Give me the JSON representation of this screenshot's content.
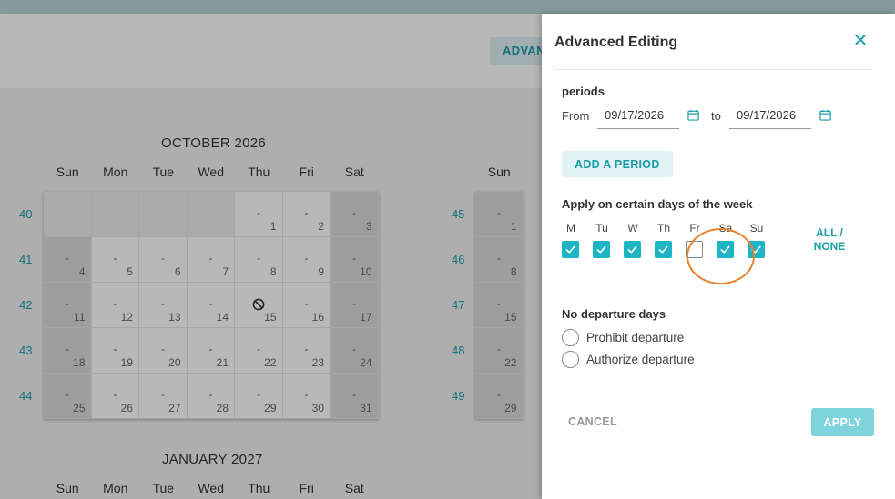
{
  "toolbar": {
    "advanced_label": "ADVAN"
  },
  "months": [
    {
      "title": "OCTOBER 2026",
      "days_of_week": [
        "Sun",
        "Mon",
        "Tue",
        "Wed",
        "Thu",
        "Fri",
        "Sat"
      ],
      "week_numbers": [
        "40",
        "41",
        "42",
        "43",
        "44"
      ],
      "weeks": [
        [
          {
            "empty": true
          },
          {
            "empty": true
          },
          {
            "empty": true
          },
          {
            "empty": true
          },
          {
            "price": "-",
            "day": "1"
          },
          {
            "price": "-",
            "day": "2"
          },
          {
            "price": "-",
            "day": "3",
            "weekend": true
          }
        ],
        [
          {
            "price": "-",
            "day": "4",
            "weekend": true
          },
          {
            "price": "-",
            "day": "5"
          },
          {
            "price": "-",
            "day": "6"
          },
          {
            "price": "-",
            "day": "7"
          },
          {
            "price": "-",
            "day": "8"
          },
          {
            "price": "-",
            "day": "9"
          },
          {
            "price": "-",
            "day": "10",
            "weekend": true
          }
        ],
        [
          {
            "price": "-",
            "day": "11",
            "weekend": true
          },
          {
            "price": "-",
            "day": "12"
          },
          {
            "price": "-",
            "day": "13"
          },
          {
            "price": "-",
            "day": "14"
          },
          {
            "blocked": true,
            "day": "15"
          },
          {
            "price": "-",
            "day": "16"
          },
          {
            "price": "-",
            "day": "17",
            "weekend": true
          }
        ],
        [
          {
            "price": "-",
            "day": "18",
            "weekend": true
          },
          {
            "price": "-",
            "day": "19"
          },
          {
            "price": "-",
            "day": "20"
          },
          {
            "price": "-",
            "day": "21"
          },
          {
            "price": "-",
            "day": "22"
          },
          {
            "price": "-",
            "day": "23"
          },
          {
            "price": "-",
            "day": "24",
            "weekend": true
          }
        ],
        [
          {
            "price": "-",
            "day": "25",
            "weekend": true
          },
          {
            "price": "-",
            "day": "26"
          },
          {
            "price": "-",
            "day": "27"
          },
          {
            "price": "-",
            "day": "28"
          },
          {
            "price": "-",
            "day": "29"
          },
          {
            "price": "-",
            "day": "30"
          },
          {
            "price": "-",
            "day": "31",
            "weekend": true
          }
        ]
      ]
    },
    {
      "title": "",
      "days_of_week": [
        "Sun"
      ],
      "week_numbers": [
        "45",
        "46",
        "47",
        "48",
        "49"
      ],
      "weeks": [
        [
          {
            "price": "-",
            "day": "1",
            "weekend": true
          }
        ],
        [
          {
            "price": "-",
            "day": "8",
            "weekend": true
          }
        ],
        [
          {
            "price": "-",
            "day": "15",
            "weekend": true
          }
        ],
        [
          {
            "price": "-",
            "day": "22",
            "weekend": true
          }
        ],
        [
          {
            "price": "-",
            "day": "29",
            "weekend": true
          }
        ]
      ]
    },
    {
      "title": "JANUARY 2027",
      "days_of_week": [
        "Sun",
        "Mon",
        "Tue",
        "Wed",
        "Thu",
        "Fri",
        "Sat"
      ]
    }
  ],
  "drawer": {
    "title": "Advanced Editing",
    "close_symbol": "✕",
    "periods_label": "periods",
    "from_label": "From",
    "from_value": "09/17/2026",
    "to_label": "to",
    "to_value": "09/17/2026",
    "add_period_label": "ADD A PERIOD",
    "days_section_label": "Apply on certain days of the week",
    "days": [
      {
        "label": "M",
        "checked": true
      },
      {
        "label": "Tu",
        "checked": true
      },
      {
        "label": "W",
        "checked": true
      },
      {
        "label": "Th",
        "checked": true
      },
      {
        "label": "Fr",
        "checked": false
      },
      {
        "label": "Sa",
        "checked": true
      },
      {
        "label": "Su",
        "checked": true
      }
    ],
    "all_none_label": "ALL / NONE",
    "no_departure_label": "No departure days",
    "radio_options": [
      {
        "label": "Prohibit departure",
        "selected": false
      },
      {
        "label": "Authorize departure",
        "selected": false
      }
    ],
    "cancel_label": "CANCEL",
    "apply_label": "APPLY"
  },
  "colors": {
    "accent": "#1a9daa",
    "checkbox": "#1db5c4",
    "apply_disabled": "#7fd3dc",
    "focus_ring": "#e8822c"
  },
  "icons": {
    "close": "close-icon",
    "calendar": "calendar-icon",
    "check": "check-icon",
    "blocked": "blocked-icon"
  }
}
